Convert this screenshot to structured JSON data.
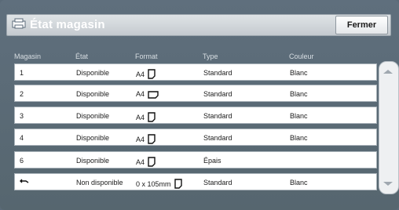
{
  "window": {
    "title": "État magasin",
    "close_label": "Fermer",
    "title_icon": "printer-icon"
  },
  "columns": [
    "Magasin",
    "État",
    "Format",
    "Type",
    "Couleur"
  ],
  "rows": [
    {
      "magasin": "1",
      "etat": "Disponible",
      "format": "A4",
      "orientation": "portrait",
      "type": "Standard",
      "couleur": "Blanc"
    },
    {
      "magasin": "2",
      "etat": "Disponible",
      "format": "A4",
      "orientation": "landscape",
      "type": "Standard",
      "couleur": "Blanc"
    },
    {
      "magasin": "3",
      "etat": "Disponible",
      "format": "A4",
      "orientation": "portrait",
      "type": "Standard",
      "couleur": "Blanc"
    },
    {
      "magasin": "4",
      "etat": "Disponible",
      "format": "A4",
      "orientation": "portrait",
      "type": "Standard",
      "couleur": "Blanc"
    },
    {
      "magasin": "6",
      "etat": "Disponible",
      "format": "A4",
      "orientation": "portrait",
      "type": "Épais",
      "couleur": ""
    },
    {
      "magasin": "",
      "magasin_icon": "bypass-tray-icon",
      "etat": "Non disponible",
      "format": "0 x 105mm",
      "orientation": "portrait",
      "type": "Standard",
      "couleur": "Blanc"
    }
  ],
  "scrollbar": {
    "up_icon": "scroll-up-icon",
    "down_icon": "scroll-down-icon"
  }
}
